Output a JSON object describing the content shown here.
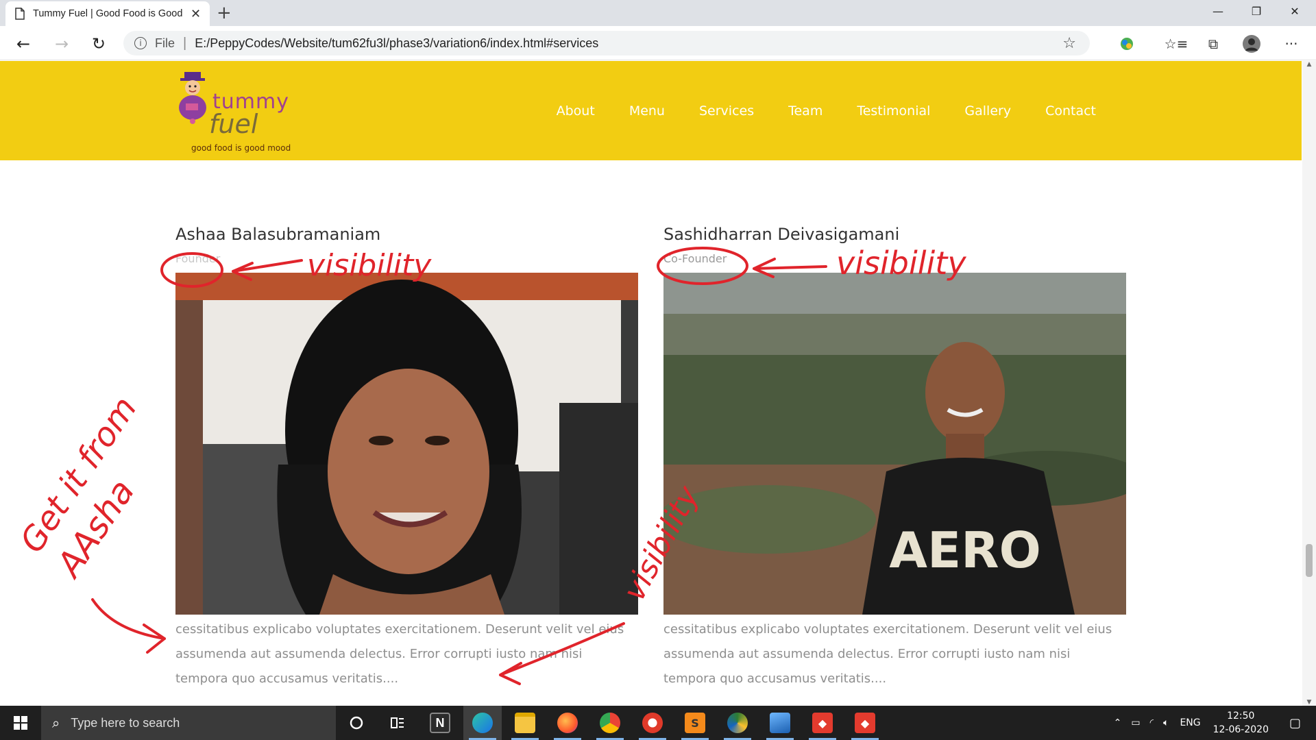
{
  "browser": {
    "tab_title": "Tummy Fuel | Good Food is Good Mood",
    "new_tab_icon": "plus-icon",
    "address_scheme_label": "File",
    "url": "E:/PeppyCodes/Website/tum62fu3l/phase3/variation6/index.html#services"
  },
  "site": {
    "logo": {
      "line1": "tummy",
      "line2": "fuel",
      "tagline": "good food is good mood"
    },
    "nav": [
      "About",
      "Menu",
      "Services",
      "Team",
      "Testimonial",
      "Gallery",
      "Contact"
    ],
    "colors": {
      "header": "#f2cd12",
      "nav_text": "#ffffff",
      "annotation": "#e0242b"
    }
  },
  "team": [
    {
      "name": "Ashaa Balasubramaniam",
      "role": "Founder",
      "desc": "cessitatibus explicabo voluptates exercitationem. Deserunt velit vel eius assumenda aut assumenda delectus. Error corrupti iusto nam nisi tempora quo accusamus veritatis...."
    },
    {
      "name": "Sashidharran Deivasigamani",
      "role": "Co-Founder",
      "desc": "cessitatibus explicabo voluptates exercitationem. Deserunt velit vel eius assumenda aut assumenda delectus. Error corrupti iusto nam nisi tempora quo accusamus veritatis...."
    }
  ],
  "annotations": {
    "visibility_1": "visibility",
    "visibility_2": "visibility",
    "visibility_3": "visibility",
    "get_from": "Get it from",
    "aasha": "AAsha"
  },
  "taskbar": {
    "search_placeholder": "Type here to search",
    "language": "ENG",
    "time": "12:50",
    "date": "12-06-2020"
  }
}
